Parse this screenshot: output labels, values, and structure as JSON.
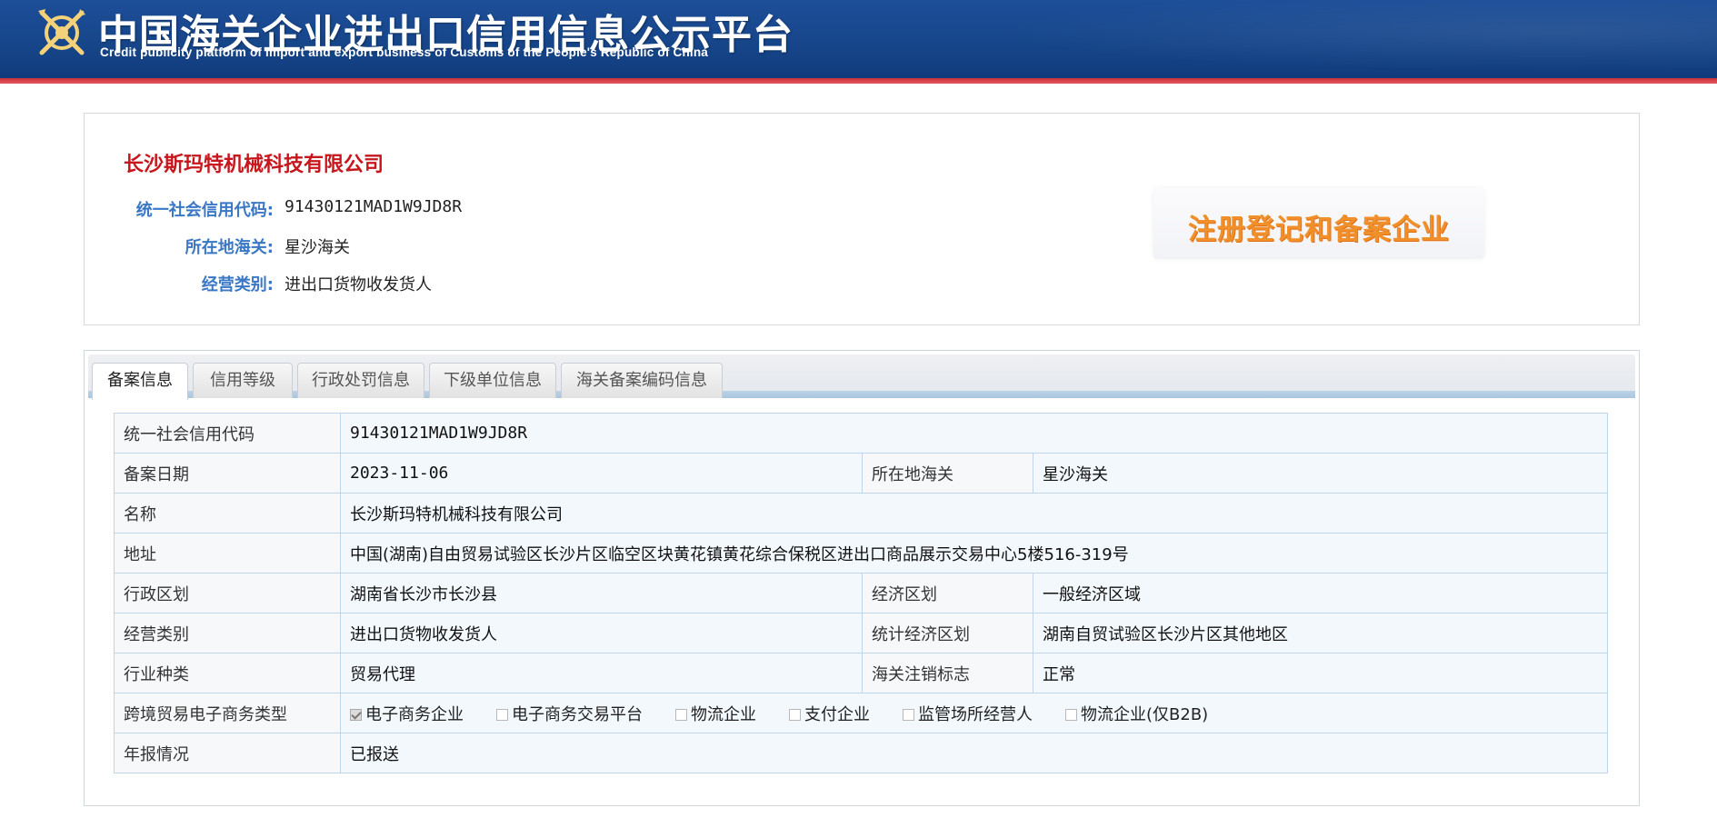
{
  "header": {
    "title": "中国海关企业进出口信用信息公示平台",
    "subtitle": "Credit publicity platform of import and export business of Customs of the People's Republic of China"
  },
  "summary": {
    "company_name": "长沙斯玛特机械科技有限公司",
    "credit_code_label": "统一社会信用代码:",
    "credit_code": "91430121MAD1W9JD8R",
    "customs_label": "所在地海关:",
    "customs": "星沙海关",
    "business_type_label": "经营类别:",
    "business_type": "进出口货物收发货人",
    "badge": "注册登记和备案企业"
  },
  "tabs": [
    {
      "label": "备案信息",
      "active": true
    },
    {
      "label": "信用等级",
      "active": false
    },
    {
      "label": "行政处罚信息",
      "active": false
    },
    {
      "label": "下级单位信息",
      "active": false
    },
    {
      "label": "海关备案编码信息",
      "active": false
    }
  ],
  "detail": {
    "credit_code_label": "统一社会信用代码",
    "credit_code": "91430121MAD1W9JD8R",
    "record_date_label": "备案日期",
    "record_date": "2023-11-06",
    "customs_label": "所在地海关",
    "customs": "星沙海关",
    "name_label": "名称",
    "name": "长沙斯玛特机械科技有限公司",
    "address_label": "地址",
    "address": "中国(湖南)自由贸易试验区长沙片区临空区块黄花镇黄花综合保税区进出口商品展示交易中心5楼516-319号",
    "admin_region_label": "行政区划",
    "admin_region": "湖南省长沙市长沙县",
    "econ_zone_label": "经济区划",
    "econ_zone": "一般经济区域",
    "business_type_label": "经营类别",
    "business_type": "进出口货物收发货人",
    "stat_zone_label": "统计经济区划",
    "stat_zone": "湖南自贸试验区长沙片区其他地区",
    "industry_label": "行业种类",
    "industry": "贸易代理",
    "cancel_flag_label": "海关注销标志",
    "cancel_flag": "正常",
    "ecommerce_label": "跨境贸易电子商务类型",
    "ecommerce_options": [
      {
        "label": "电子商务企业",
        "checked": true
      },
      {
        "label": "电子商务交易平台",
        "checked": false
      },
      {
        "label": "物流企业",
        "checked": false
      },
      {
        "label": "支付企业",
        "checked": false
      },
      {
        "label": "监管场所经营人",
        "checked": false
      },
      {
        "label": "物流企业(仅B2B)",
        "checked": false
      }
    ],
    "annual_report_label": "年报情况",
    "annual_report": "已报送"
  },
  "colors": {
    "header_bg": "#164589",
    "header_rule": "#d8454b",
    "company_name": "#c8161d",
    "label_blue": "#3a77c4",
    "badge_orange": "#f0902a",
    "table_border": "#bfd6ea"
  },
  "icons": {
    "logo": "customs-emblem-icon"
  }
}
